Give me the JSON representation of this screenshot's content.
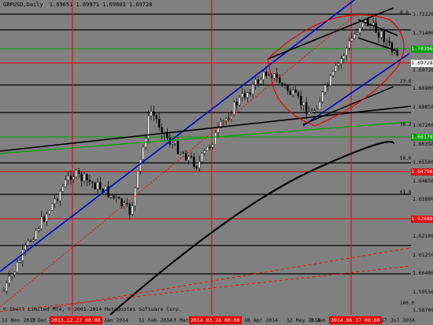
{
  "header": {
    "symbol": "GBPUSD,Daily",
    "ohlc": "1.69651 1.69971 1.69603 1.69728"
  },
  "copyright": "© Ibell Limited MT4, © 2001-2014 MetaQuotes Software Corp.",
  "price_axis": {
    "labels": [
      "1.72220",
      "1.71400",
      "1.70550",
      "1.69728",
      "1.68900",
      "1.68050",
      "1.67200",
      "1.66350",
      "1.65500",
      "1.64650",
      "1.63800",
      "1.62950",
      "1.62100",
      "1.61250",
      "1.60400",
      "1.59550",
      "1.58700"
    ],
    "boxes": [
      {
        "text": "1.70396",
        "bg": "#00a000"
      },
      {
        "text": "1.69728",
        "bg": "#ffffff",
        "fg": "#000000"
      },
      {
        "text": "1.66178",
        "bg": "#00a000"
      },
      {
        "text": "1.64798",
        "bg": "#e60000"
      },
      {
        "text": "1.62688",
        "bg": "#e60000"
      }
    ]
  },
  "time_axis": {
    "labels": [
      "11 Nov 2013",
      "3 Dec",
      "20 Jan 2014",
      "11 Feb 2014",
      "3 Mar",
      "18 Apr 2014",
      "12 May 2014",
      "3 Jun 2014",
      "17 Jul 2014"
    ],
    "highlights": [
      "2013.12.27 00:00",
      "2014.03.28 00:00",
      "2014.06.27 00:00"
    ]
  },
  "fib_levels": [
    "0.0",
    "23.6",
    "38.2",
    "50.0",
    "61.8",
    "100.0"
  ],
  "colors": {
    "background": "#808080",
    "candle_bull": "#ffffff",
    "candle_bear": "#000000",
    "horizontal_black": "#000000",
    "horizontal_red": "#e60000",
    "horizontal_green": "#00a000",
    "channel_blue": "#0000cc",
    "moving_average": "#000000",
    "annotation_red": "#e60000"
  }
}
